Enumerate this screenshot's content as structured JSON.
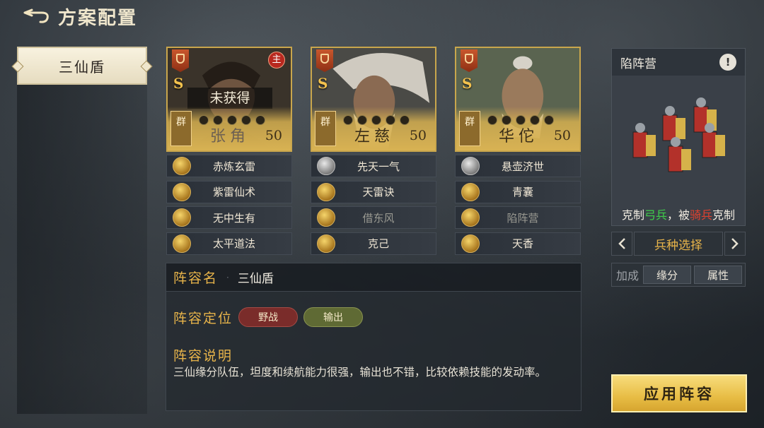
{
  "header": {
    "title": "方案配置"
  },
  "plans": [
    {
      "label": "三仙盾"
    }
  ],
  "generals": [
    {
      "grade": "S",
      "faction": "群",
      "name": "张角",
      "level": "50",
      "status": "未获得",
      "lead_badge": "主",
      "skills": [
        "赤炼玄雷",
        "紫雷仙术",
        "无中生有",
        "太平道法"
      ]
    },
    {
      "grade": "S",
      "faction": "群",
      "name": "左慈",
      "level": "50",
      "skills": [
        "先天一气",
        "天雷诀",
        "借东风",
        "克己"
      ]
    },
    {
      "grade": "S",
      "faction": "群",
      "name": "华佗",
      "level": "50",
      "skills": [
        "悬壶济世",
        "青囊",
        "陷阵营",
        "天香"
      ]
    }
  ],
  "lineup": {
    "name_label": "阵容名",
    "name_value": "三仙盾",
    "position_label": "阵容定位",
    "tags": [
      "野战",
      "输出"
    ],
    "desc_label": "阵容说明",
    "desc_text": "三仙缘分队伍，坦度和续航能力很强，输出也不错，比较依赖技能的发动率。"
  },
  "troop": {
    "name": "陷阵营",
    "info_glyph": "!",
    "counter": {
      "p1": "克制",
      "good": "弓兵",
      "p2": "，被",
      "bad": "骑兵",
      "p3": "克制"
    },
    "select_label": "兵种选择"
  },
  "bonus": {
    "label": "加成",
    "tabs": [
      "缘分",
      "属性"
    ]
  },
  "apply_label": "应用阵容",
  "colors": {
    "accent_gold": "#e8b44a",
    "counter_good": "#3fd14a",
    "counter_bad": "#e0412f"
  }
}
